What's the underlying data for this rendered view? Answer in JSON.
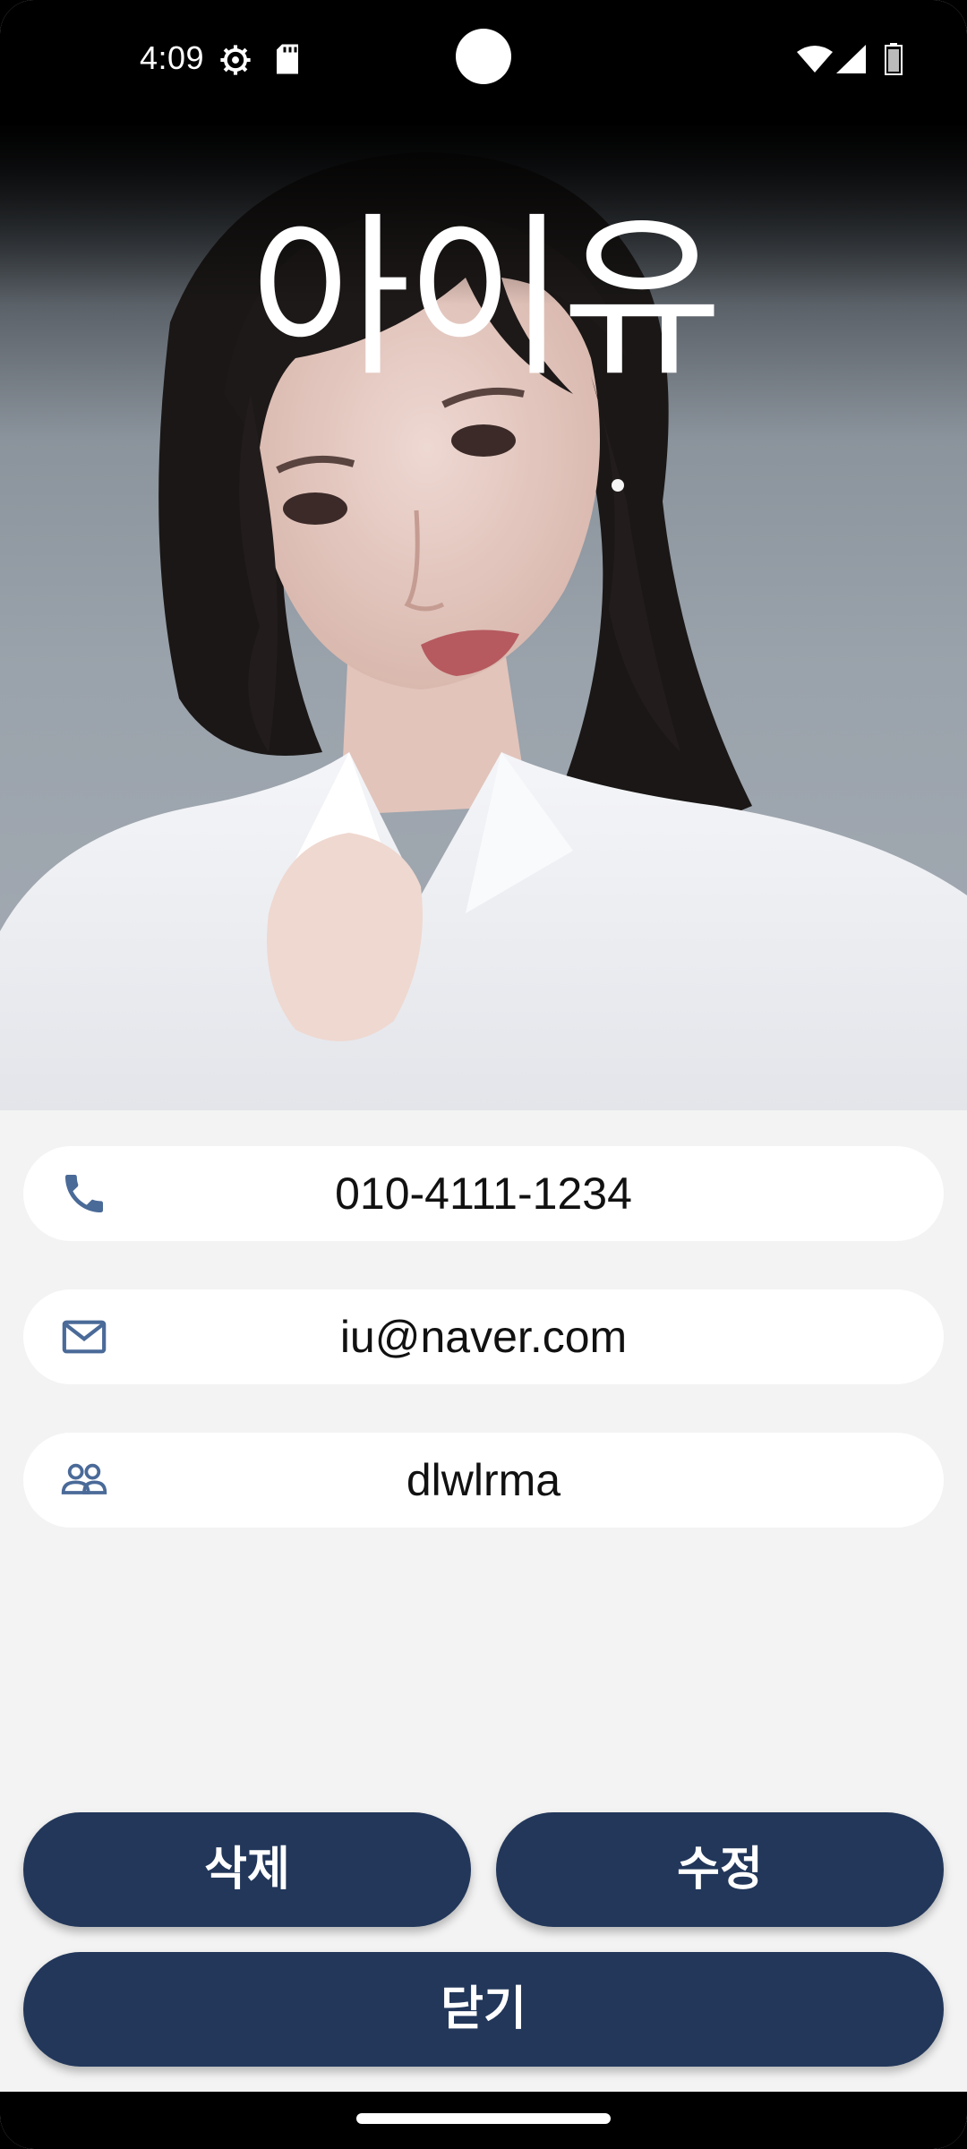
{
  "status_bar": {
    "time": "4:09",
    "icons": [
      "settings-gear-icon",
      "sd-card-icon",
      "wifi-icon",
      "cell-signal-icon",
      "battery-icon"
    ]
  },
  "contact": {
    "name": "아이유",
    "phone": "010-4111-1234",
    "email": "iu@naver.com",
    "group": "dlwlrma"
  },
  "buttons": {
    "delete_label": "삭제",
    "edit_label": "수정",
    "close_label": "닫기"
  },
  "colors": {
    "button_bg": "#22375a",
    "icon_color": "#4a6a98",
    "background": "#f3f3f3"
  }
}
